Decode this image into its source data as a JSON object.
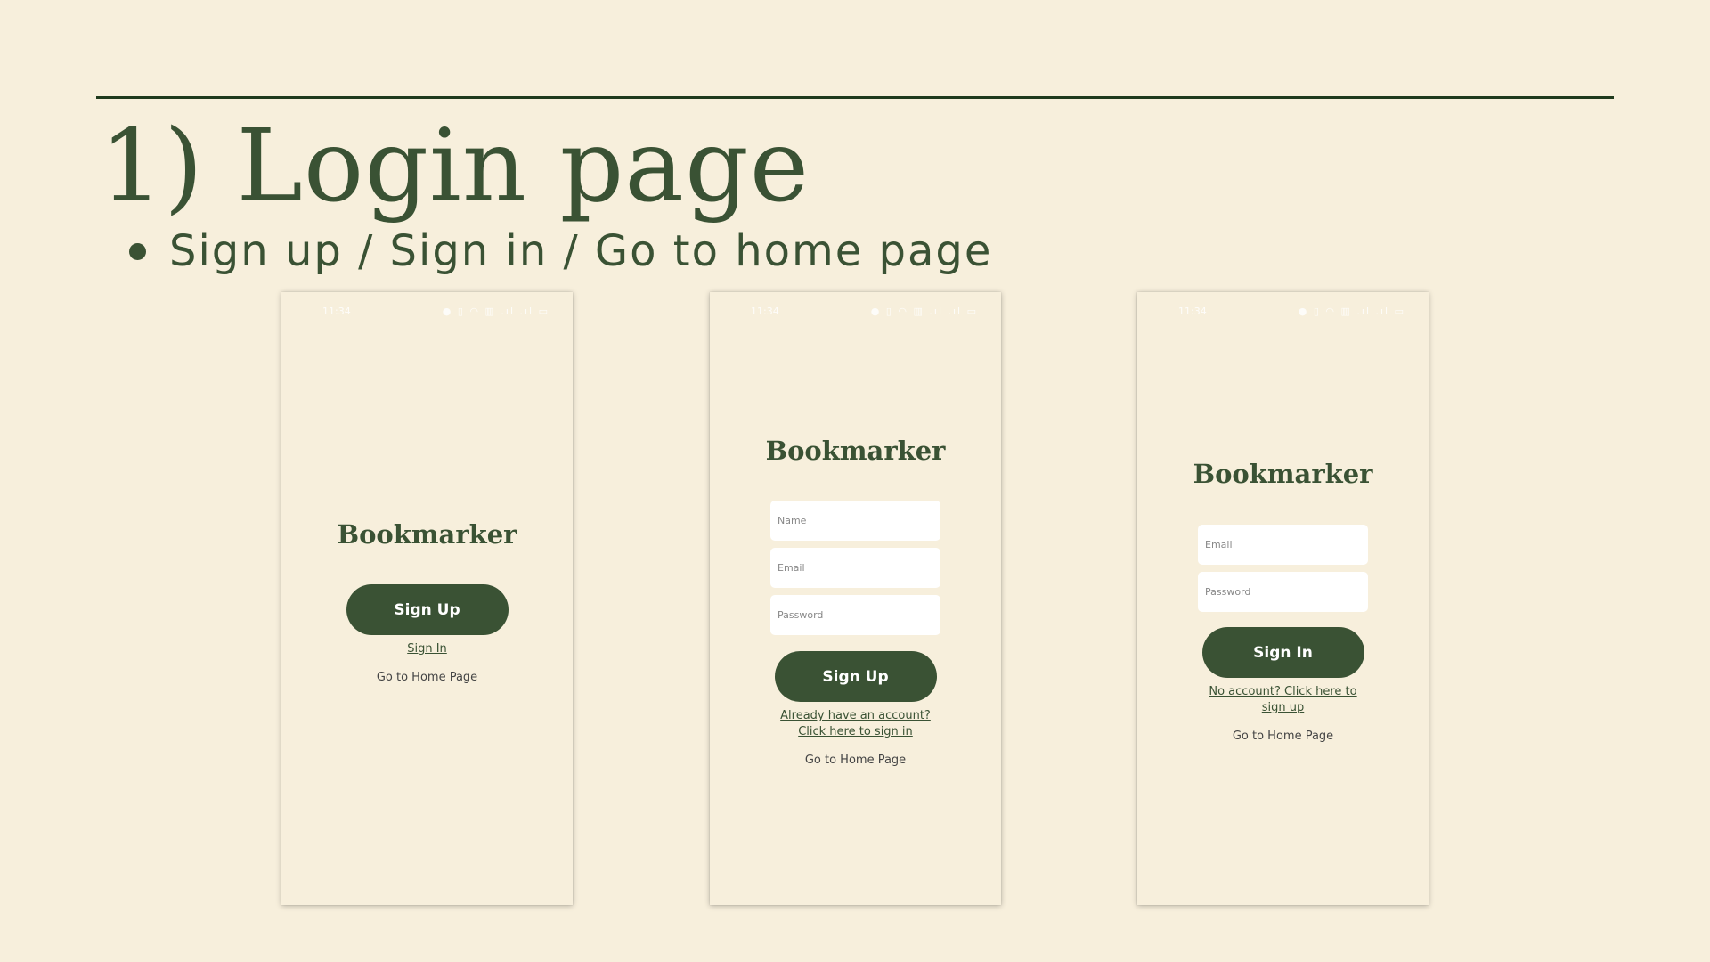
{
  "slide": {
    "title": "1) Login page",
    "bullet": "Sign up / Sign in / Go to home page"
  },
  "status_bar": {
    "time": "11:34",
    "icons": "● ▯ ◠ ▥ .ıl .ıl ▭"
  },
  "colors": {
    "background": "#f7efdc",
    "accent": "#3a5234",
    "field": "#ffffff"
  },
  "screens": [
    {
      "brand": "Bookmarker",
      "primary_button": "Sign Up",
      "link_primary": "Sign In",
      "link_home": "Go to Home Page"
    },
    {
      "brand": "Bookmarker",
      "fields": [
        {
          "placeholder": "Name"
        },
        {
          "placeholder": "Email"
        },
        {
          "placeholder": "Password"
        }
      ],
      "primary_button": "Sign Up",
      "link_line1": "Already have an account?",
      "link_line2": "Click here to sign in",
      "link_home": "Go to Home Page"
    },
    {
      "brand": "Bookmarker",
      "fields": [
        {
          "placeholder": "Email"
        },
        {
          "placeholder": "Password"
        }
      ],
      "primary_button": "Sign In",
      "link_line1": "No account? Click here to",
      "link_line2": "sign up",
      "link_home": "Go to Home Page"
    }
  ]
}
